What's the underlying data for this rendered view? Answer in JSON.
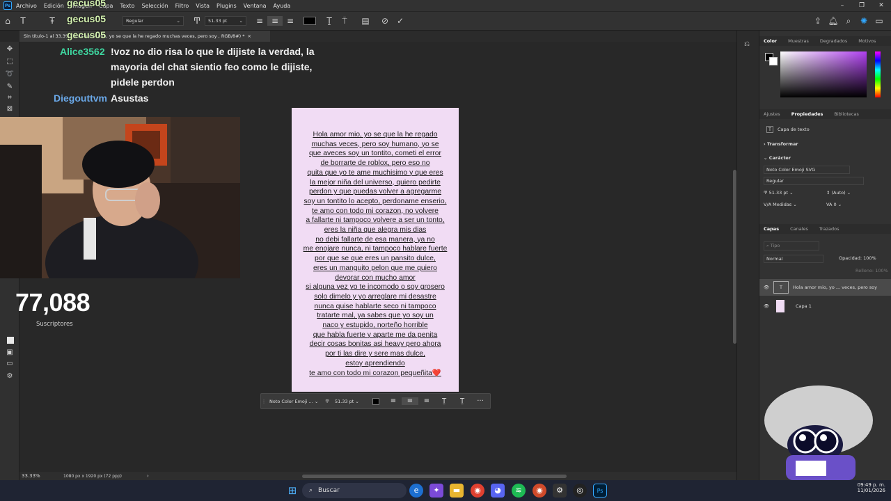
{
  "menubar": {
    "app_icon": "Ps",
    "items": [
      "Archivo",
      "Edición",
      "Imagen",
      "Capa",
      "Texto",
      "Selección",
      "Filtro",
      "Vista",
      "Plugins",
      "Ventana",
      "Ayuda"
    ],
    "window_controls": [
      "–",
      "❐",
      "✕"
    ]
  },
  "options": {
    "font_style": "Regular",
    "font_size": "51.33 pt",
    "text_color": "#000000"
  },
  "document_tab": {
    "title": "Sin título-1 al 33.3% (Hola amor mio, yo se que la he regado  muchas veces, pero  soy , RGB/8#) *",
    "close": "×"
  },
  "chat": {
    "ghost_users": [
      "gecus05",
      "gecus05",
      "gecus05"
    ],
    "messages": [
      {
        "user": "Alice3562",
        "user_color": "#3ed6a0",
        "lines": [
          "!voz no dio risa lo que le dijiste la verdad, la",
          "mayoria del chat sientio feo como le dijiste,",
          "pidele perdon"
        ]
      },
      {
        "user": "Diegouttvm",
        "user_color": "#6aa8e8",
        "lines": [
          "Asustas"
        ]
      }
    ]
  },
  "subscribers": {
    "count": "77,088",
    "label": "Suscriptores"
  },
  "document_text": [
    "Hola amor mio, yo se que la he regado",
    "muchas veces, pero  soy humano, yo se",
    "que aveces soy un tontito, cometi el error",
    "de borrarte de roblox, pero eso no",
    "quita que yo te ame muchisimo y que eres",
    "la mejor niña del universo, quiero pedirte",
    "perdon y que puedas volver a agregarme",
    "soy un tontito lo acepto, perdoname enserio,",
    "te amo con todo mi corazon, no volvere",
    "a fallarte ni tampoco volvere a ser un tonto,",
    "eres la niña que alegra mis dias",
    "no debi fallarte de esa manera, ya no",
    "me enojare nunca, ni tampoco hablare fuerte",
    "por que se que eres un pansito dulce,",
    "eres un manguito pelon que me quiero",
    "devorar con mucho amor",
    "si alguna vez yo te incomodo o soy grosero",
    "solo dimelo y yo arreglare mi desastre",
    "nunca quise hablarte seco ni tampoco",
    "tratarte mal, ya sabes que yo soy un",
    "naco y estupido, norteño horrible",
    "que habla fuerte y aparte me da penita",
    "decir cosas bonitas asi heavy pero ahora",
    "por ti las dire y sere mas dulce,",
    "estoy aprendiendo",
    "te amo con todo mi corazon pequeñita❤️"
  ],
  "context_bar": {
    "font": "Noto Color Emoji ...",
    "size": "51.33 pt",
    "more": "···"
  },
  "status": {
    "zoom": "33.33%",
    "doc_info": "1080 px x 1920 px (72 ppp)"
  },
  "panels": {
    "color_tabs": [
      "Color",
      "Muestras",
      "Degradados",
      "Motivos"
    ],
    "props_tabs": [
      "Ajustes",
      "Propiedades",
      "Bibliotecas"
    ],
    "text_layer_label": "Capa de texto",
    "transform_label": "Transformar",
    "character_label": "Carácter",
    "font_family": "Noto Color Emoji SVG",
    "font_style": "Regular",
    "size": "51.33 pt",
    "leading": "(Auto)",
    "kerning": "Medidas",
    "tracking": "0",
    "layers_tabs": [
      "Capas",
      "Canales",
      "Trazados"
    ],
    "filter_placeholder": "Tipo",
    "blend_mode": "Normal",
    "opacity_label": "Opacidad:",
    "opacity_value": "100%",
    "fill_label": "Relleno:",
    "fill_value": "100%",
    "layers": [
      {
        "name": "Hola amor mio, yo ... veces, pero  soy",
        "kind": "text"
      },
      {
        "name": "Capa 1",
        "kind": "pixel"
      }
    ]
  },
  "taskbar": {
    "search_label": "Buscar",
    "time": "09:49 p. m.",
    "date": "11/01/2026"
  },
  "colors": {
    "accent": "#31a8ff",
    "document_bg": "#f1dcf4",
    "app_bg": "#282828"
  }
}
